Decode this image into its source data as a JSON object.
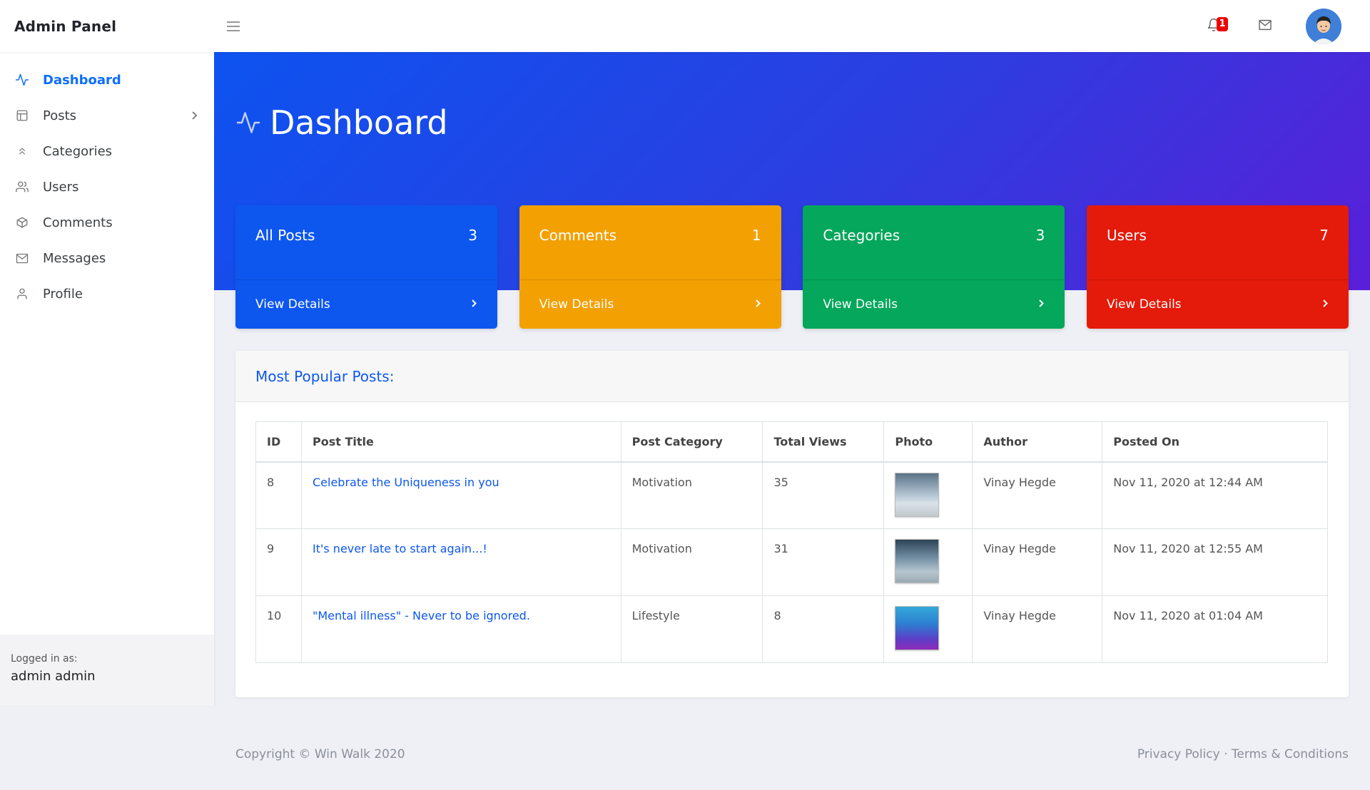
{
  "app": {
    "brand": "Admin Panel"
  },
  "topbar": {
    "notification_count": "1"
  },
  "sidebar": {
    "items": [
      {
        "label": "Dashboard",
        "icon": "activity-icon"
      },
      {
        "label": "Posts",
        "icon": "layout-icon"
      },
      {
        "label": "Categories",
        "icon": "chevrons-up-icon"
      },
      {
        "label": "Users",
        "icon": "users-icon"
      },
      {
        "label": "Comments",
        "icon": "package-icon"
      },
      {
        "label": "Messages",
        "icon": "mail-icon"
      },
      {
        "label": "Profile",
        "icon": "user-icon"
      }
    ],
    "footer": {
      "logged_label": "Logged in as:",
      "user": "admin admin"
    }
  },
  "hero": {
    "title": "Dashboard"
  },
  "cards": [
    {
      "label": "All Posts",
      "count": "3",
      "link": "View Details",
      "color": "#0d57ee"
    },
    {
      "label": "Comments",
      "count": "1",
      "link": "View Details",
      "color": "#f3a002"
    },
    {
      "label": "Categories",
      "count": "3",
      "link": "View Details",
      "color": "#04a75b"
    },
    {
      "label": "Users",
      "count": "7",
      "link": "View Details",
      "color": "#e41a0a"
    }
  ],
  "popular": {
    "heading": "Most Popular Posts:",
    "columns": [
      "ID",
      "Post Title",
      "Post Category",
      "Total Views",
      "Photo",
      "Author",
      "Posted On"
    ],
    "rows": [
      {
        "id": "8",
        "title": "Celebrate the Uniqueness in you",
        "category": "Motivation",
        "views": "35",
        "author": "Vinay Hegde",
        "posted": "Nov 11, 2020 at 12:44 AM"
      },
      {
        "id": "9",
        "title": "It's never late to start again...!",
        "category": "Motivation",
        "views": "31",
        "author": "Vinay Hegde",
        "posted": "Nov 11, 2020 at 12:55 AM"
      },
      {
        "id": "10",
        "title": "\"Mental illness\" - Never to be ignored.",
        "category": "Lifestyle",
        "views": "8",
        "author": "Vinay Hegde",
        "posted": "Nov 11, 2020 at 01:04 AM"
      }
    ]
  },
  "footer": {
    "copyright": "Copyright © Win Walk 2020",
    "privacy": "Privacy Policy",
    "separator": "·",
    "terms": "Terms & Conditions"
  }
}
